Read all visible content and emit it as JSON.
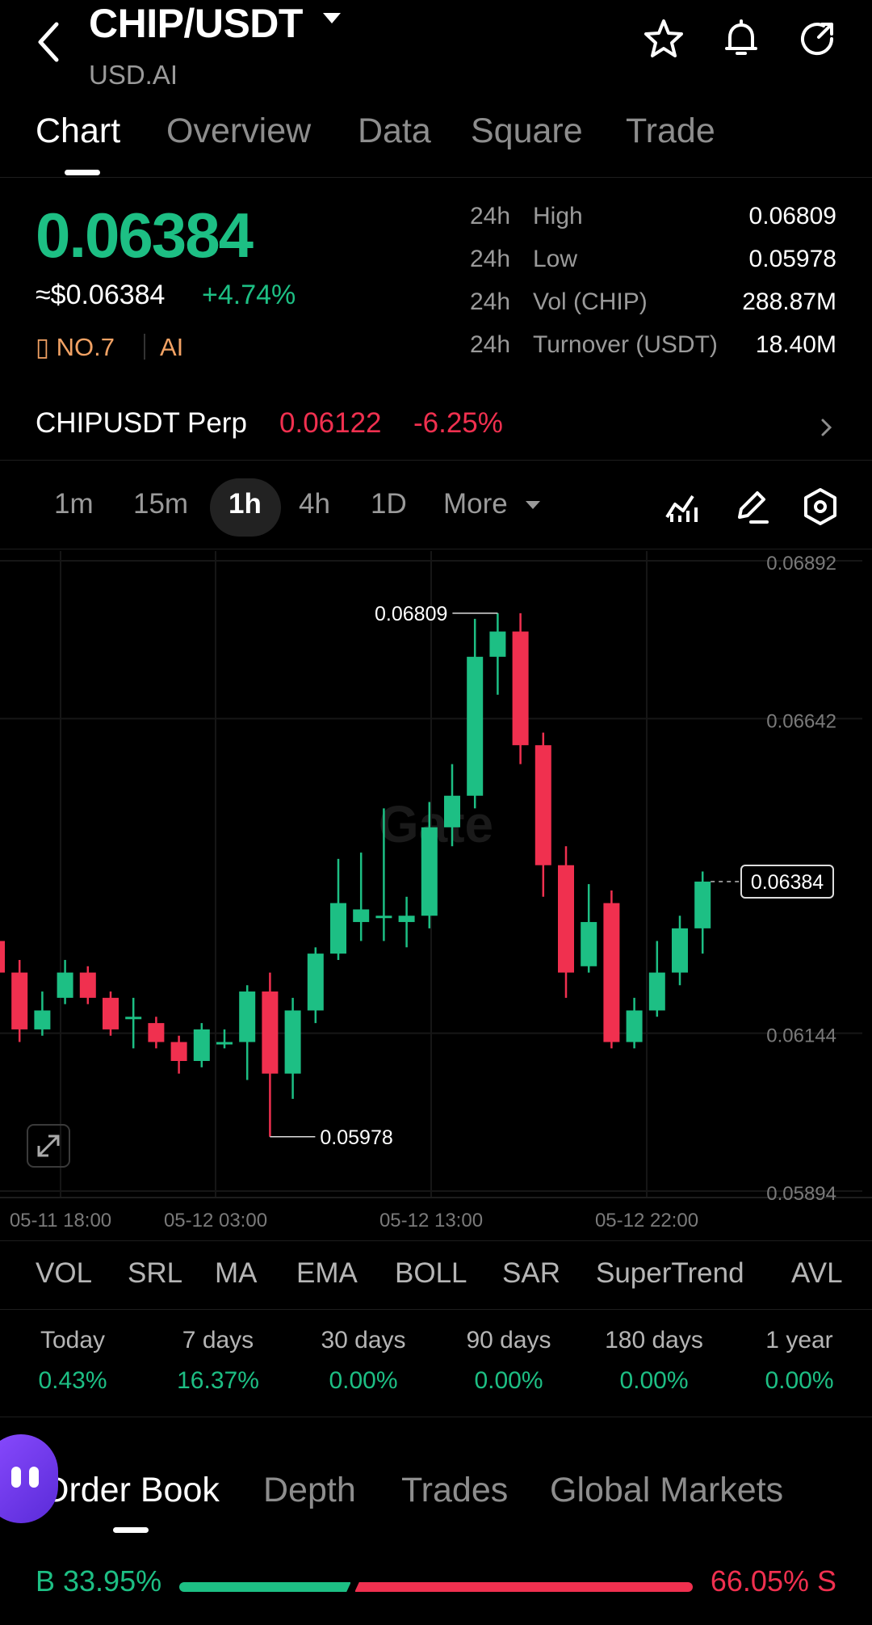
{
  "header": {
    "pair": "CHIP/USDT",
    "subtitle": "USD.AI"
  },
  "tabs": [
    "Chart",
    "Overview",
    "Data",
    "Square",
    "Trade"
  ],
  "ticker": {
    "price": "0.06384",
    "usd_price": "≈$0.06384",
    "change": "+4.74%",
    "rank": "NO.7",
    "tag": "AI",
    "stats": [
      {
        "prefix": "24h",
        "label": "High",
        "value": "0.06809"
      },
      {
        "prefix": "24h",
        "label": "Low",
        "value": "0.05978"
      },
      {
        "prefix": "24h",
        "label": "Vol (CHIP)",
        "value": "288.87M"
      },
      {
        "prefix": "24h",
        "label": "Turnover (USDT)",
        "value": "18.40M"
      }
    ]
  },
  "perp": {
    "name": "CHIPUSDT Perp",
    "price": "0.06122",
    "change": "-6.25%"
  },
  "timeframes": [
    "1m",
    "15m",
    "1h",
    "4h",
    "1D",
    "More"
  ],
  "active_timeframe": "1h",
  "chart_data": {
    "type": "candlestick",
    "ylim": [
      0.05894,
      0.06892
    ],
    "y_ticks": [
      "0.06892",
      "0.06642",
      "0.06144",
      "0.05894"
    ],
    "x_ticks": [
      "05-11 18:00",
      "05-12 03:00",
      "05-12 13:00",
      "05-12 22:00"
    ],
    "high_label": "0.06809",
    "low_label": "0.05978",
    "last_label": "0.06384",
    "watermark": "Gate",
    "candles": [
      {
        "o": 0.0629,
        "c": 0.0624,
        "h": 0.0639,
        "l": 0.0622
      },
      {
        "o": 0.0624,
        "c": 0.0615,
        "h": 0.0626,
        "l": 0.0613
      },
      {
        "o": 0.0615,
        "c": 0.0618,
        "h": 0.0621,
        "l": 0.0614
      },
      {
        "o": 0.062,
        "c": 0.0624,
        "h": 0.0626,
        "l": 0.0619
      },
      {
        "o": 0.0624,
        "c": 0.062,
        "h": 0.0625,
        "l": 0.0619
      },
      {
        "o": 0.062,
        "c": 0.0615,
        "h": 0.0621,
        "l": 0.0614
      },
      {
        "o": 0.0617,
        "c": 0.0617,
        "h": 0.062,
        "l": 0.0612
      },
      {
        "o": 0.0616,
        "c": 0.0613,
        "h": 0.0617,
        "l": 0.0612
      },
      {
        "o": 0.0613,
        "c": 0.061,
        "h": 0.0614,
        "l": 0.0608
      },
      {
        "o": 0.061,
        "c": 0.0615,
        "h": 0.0616,
        "l": 0.0609
      },
      {
        "o": 0.0613,
        "c": 0.0613,
        "h": 0.0615,
        "l": 0.0612
      },
      {
        "o": 0.0613,
        "c": 0.0621,
        "h": 0.0622,
        "l": 0.0607
      },
      {
        "o": 0.0621,
        "c": 0.0608,
        "h": 0.0624,
        "l": 0.0598
      },
      {
        "o": 0.0608,
        "c": 0.0618,
        "h": 0.062,
        "l": 0.0604
      },
      {
        "o": 0.0618,
        "c": 0.0627,
        "h": 0.0628,
        "l": 0.0616
      },
      {
        "o": 0.0627,
        "c": 0.0635,
        "h": 0.0642,
        "l": 0.0626
      },
      {
        "o": 0.0632,
        "c": 0.0634,
        "h": 0.0643,
        "l": 0.0629
      },
      {
        "o": 0.0633,
        "c": 0.0633,
        "h": 0.065,
        "l": 0.0629
      },
      {
        "o": 0.0632,
        "c": 0.0633,
        "h": 0.0636,
        "l": 0.0628
      },
      {
        "o": 0.0633,
        "c": 0.0647,
        "h": 0.0651,
        "l": 0.0631
      },
      {
        "o": 0.0647,
        "c": 0.0652,
        "h": 0.0657,
        "l": 0.0644
      },
      {
        "o": 0.0652,
        "c": 0.0674,
        "h": 0.068,
        "l": 0.065
      },
      {
        "o": 0.0674,
        "c": 0.0678,
        "h": 0.06809,
        "l": 0.0668
      },
      {
        "o": 0.0678,
        "c": 0.066,
        "h": 0.06809,
        "l": 0.0657
      },
      {
        "o": 0.066,
        "c": 0.0641,
        "h": 0.0662,
        "l": 0.0636
      },
      {
        "o": 0.0641,
        "c": 0.0624,
        "h": 0.0644,
        "l": 0.062
      },
      {
        "o": 0.0625,
        "c": 0.0632,
        "h": 0.0638,
        "l": 0.0624
      },
      {
        "o": 0.0635,
        "c": 0.0613,
        "h": 0.0637,
        "l": 0.0612
      },
      {
        "o": 0.0613,
        "c": 0.0618,
        "h": 0.062,
        "l": 0.0612
      },
      {
        "o": 0.0618,
        "c": 0.0624,
        "h": 0.0629,
        "l": 0.0617
      },
      {
        "o": 0.0624,
        "c": 0.0631,
        "h": 0.0633,
        "l": 0.0622
      },
      {
        "o": 0.0631,
        "c": 0.06384,
        "h": 0.064,
        "l": 0.0627
      }
    ]
  },
  "indicators": [
    "VOL",
    "SRL",
    "MA",
    "EMA",
    "BOLL",
    "SAR",
    "SuperTrend",
    "AVL"
  ],
  "performance": [
    {
      "label": "Today",
      "value": "0.43%"
    },
    {
      "label": "7 days",
      "value": "16.37%"
    },
    {
      "label": "30 days",
      "value": "0.00%"
    },
    {
      "label": "90 days",
      "value": "0.00%"
    },
    {
      "label": "180 days",
      "value": "0.00%"
    },
    {
      "label": "1 year",
      "value": "0.00%"
    }
  ],
  "orderbook_tabs": [
    "Order Book",
    "Depth",
    "Trades",
    "Global Markets"
  ],
  "ratio": {
    "buy_label": "B 33.95%",
    "sell_label": "66.05% S",
    "buy_fraction": 0.3395
  },
  "colors": {
    "up": "#1dbf84",
    "down": "#f0304f",
    "accent_orange": "#f2a264"
  }
}
